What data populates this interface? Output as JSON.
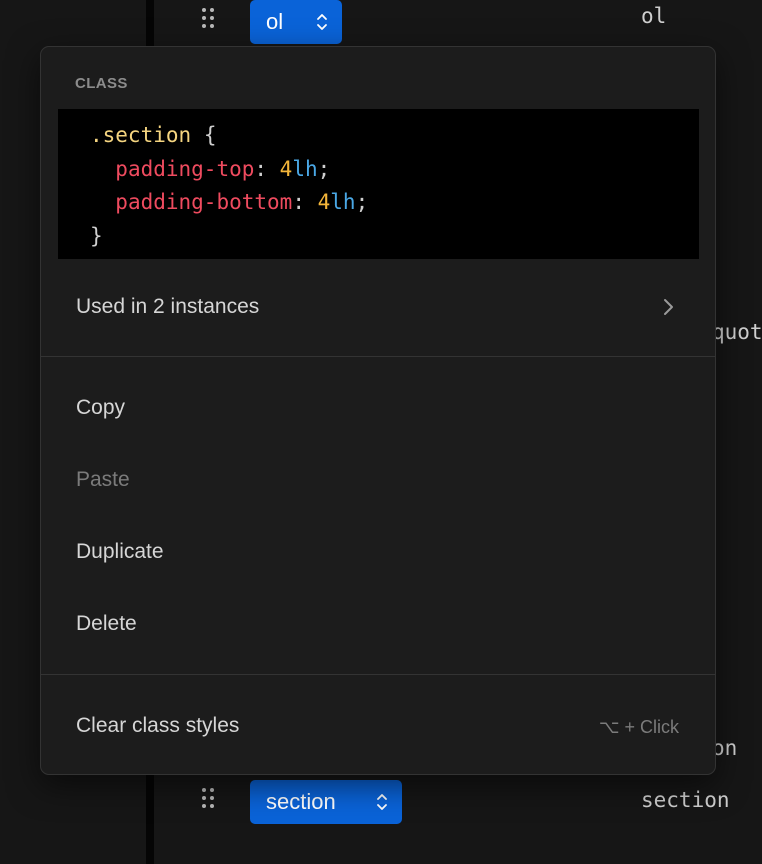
{
  "tree_rows": {
    "top": {
      "tag_select_label": "ol",
      "tag_name": "ol"
    },
    "bottom": {
      "tag_select_label": "section",
      "tag_name": "section"
    }
  },
  "partially_visible_text": {
    "right_middle": "quot",
    "right_lower": "on"
  },
  "context_menu": {
    "section_heading": "CLASS",
    "code": {
      "selector": ".section",
      "open_brace": "{",
      "close_brace": "}",
      "declarations": [
        {
          "property": "padding-top",
          "number": "4",
          "unit": "lh"
        },
        {
          "property": "padding-bottom",
          "number": "4",
          "unit": "lh"
        }
      ]
    },
    "instances_label": "Used in 2 instances",
    "items": {
      "copy": "Copy",
      "paste": "Paste",
      "duplicate": "Duplicate",
      "delete": "Delete"
    },
    "clear_styles": {
      "label": "Clear class styles",
      "shortcut": "⌥ + Click"
    }
  },
  "colors": {
    "accent": "#0a63d8",
    "selector": "#f5d580",
    "property": "#ef4b5f",
    "number": "#f4b63a",
    "unit": "#4aa8e6",
    "disabled": "#7b7b7b"
  },
  "icons": [
    "drag-handle-icon",
    "chevron-updown-icon",
    "chevron-right-icon"
  ]
}
